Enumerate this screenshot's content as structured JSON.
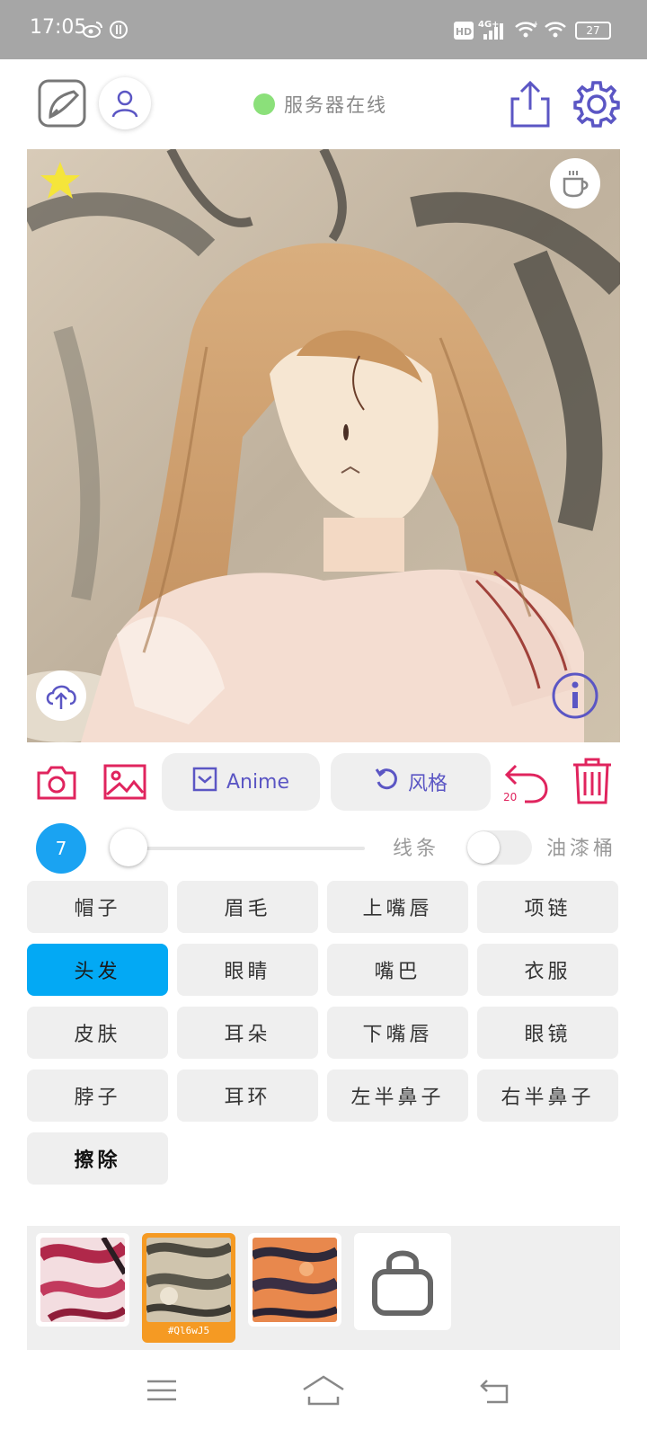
{
  "status_bar": {
    "time": "17:05",
    "battery": "27",
    "icons": [
      "weibo-icon",
      "app-icon",
      "hd-icon",
      "signal-4g-icon",
      "wifi-icon",
      "battery-icon"
    ]
  },
  "header": {
    "server_status": "服务器在线",
    "server_status_color": "#8be07a",
    "icons": [
      "sketch-icon",
      "user-icon",
      "share-icon",
      "settings-icon"
    ]
  },
  "canvas": {
    "icons": [
      "star-icon",
      "coffee-icon",
      "upload-cloud-icon",
      "info-icon"
    ]
  },
  "toolbar": {
    "mode_label": "Anime",
    "style_label": "风格",
    "undo_count": "20",
    "icons": [
      "camera-icon",
      "gallery-icon",
      "checkbox-icon",
      "refresh-icon",
      "undo-icon",
      "trash-icon"
    ]
  },
  "brush": {
    "size": "7",
    "lines_label": "线条",
    "bucket_label": "油漆桶",
    "bucket_enabled": false
  },
  "parts": [
    {
      "label": "帽子",
      "active": false
    },
    {
      "label": "眉毛",
      "active": false
    },
    {
      "label": "上嘴唇",
      "active": false
    },
    {
      "label": "项链",
      "active": false
    },
    {
      "label": "头发",
      "active": true
    },
    {
      "label": "眼睛",
      "active": false
    },
    {
      "label": "嘴巴",
      "active": false
    },
    {
      "label": "衣服",
      "active": false
    },
    {
      "label": "皮肤",
      "active": false
    },
    {
      "label": "耳朵",
      "active": false
    },
    {
      "label": "下嘴唇",
      "active": false
    },
    {
      "label": "眼镜",
      "active": false
    },
    {
      "label": "脖子",
      "active": false
    },
    {
      "label": "耳环",
      "active": false
    },
    {
      "label": "左半鼻子",
      "active": false
    },
    {
      "label": "右半鼻子",
      "active": false
    },
    {
      "label": "擦除",
      "active": false
    }
  ],
  "styles": {
    "selected_id": "#Ql6wJ5",
    "icons": [
      "lock-bag-icon"
    ]
  },
  "colors": {
    "accent_blue": "#03a9f4",
    "icon_purple": "#5b56c4",
    "icon_red": "#e0245e",
    "selected_orange": "#f59a23"
  },
  "navbar": {
    "icons": [
      "menu-icon",
      "home-icon",
      "back-icon"
    ]
  }
}
